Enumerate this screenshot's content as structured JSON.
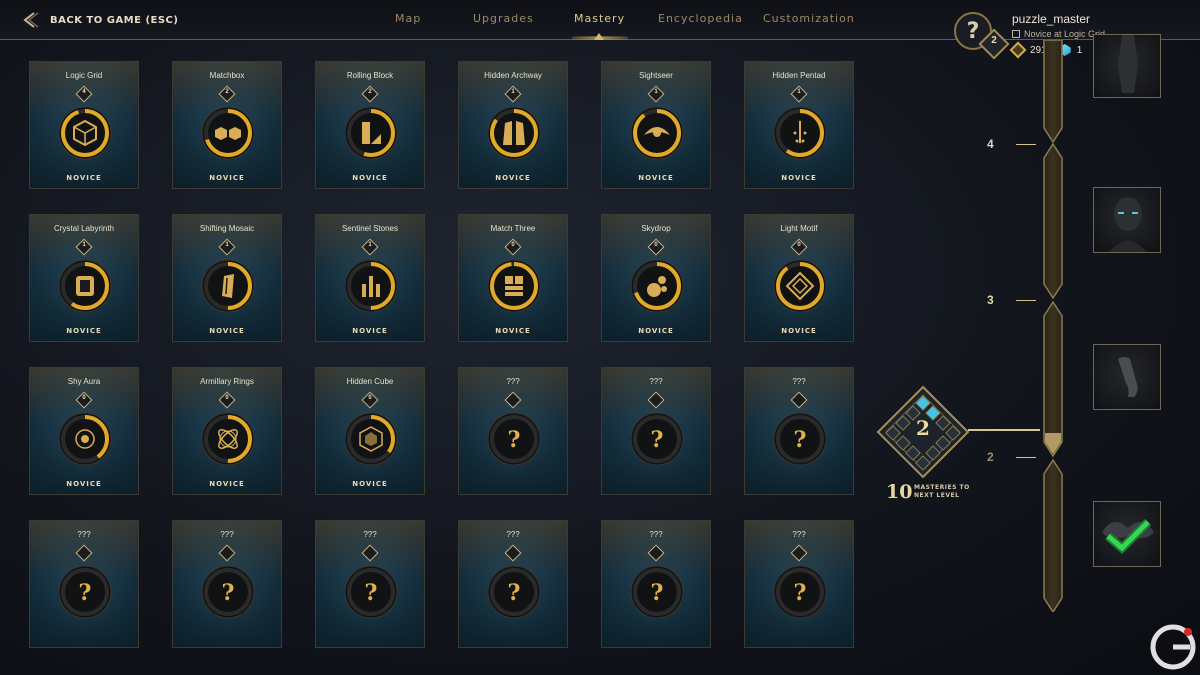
{
  "topbar": {
    "back_label": "BACK TO GAME (ESC)",
    "tabs": [
      {
        "label": "Map",
        "active": false
      },
      {
        "label": "Upgrades",
        "active": false
      },
      {
        "label": "Mastery",
        "active": true
      },
      {
        "label": "Encyclopedia",
        "active": false
      },
      {
        "label": "Customization",
        "active": false
      }
    ]
  },
  "profile": {
    "avatar_glyph": "?",
    "level": "2",
    "username": "puzzle_master",
    "rank_text": "Novice at Logic Grid",
    "coins": "291",
    "gems": "1"
  },
  "colors": {
    "accent_gold": "#e0a928",
    "ring_track": "#2a2a2a",
    "text_gold": "#e8d7a8",
    "gem_cyan": "#3fc6e8",
    "check_green": "#29c84a"
  },
  "cards": [
    {
      "name": "Logic Grid",
      "count": "4",
      "rank": "NOVICE",
      "progress": 0.95,
      "icon": "cube-icon",
      "locked": false
    },
    {
      "name": "Matchbox",
      "count": "2",
      "rank": "NOVICE",
      "progress": 0.7,
      "icon": "cubes-icon",
      "locked": false
    },
    {
      "name": "Rolling Block",
      "count": "2",
      "rank": "NOVICE",
      "progress": 0.55,
      "icon": "book-block-icon",
      "locked": false
    },
    {
      "name": "Hidden Archway",
      "count": "1",
      "rank": "NOVICE",
      "progress": 0.85,
      "icon": "archway-icon",
      "locked": false
    },
    {
      "name": "Sightseer",
      "count": "1",
      "rank": "NOVICE",
      "progress": 0.9,
      "icon": "eye-icon",
      "locked": false
    },
    {
      "name": "Hidden Pentad",
      "count": "1",
      "rank": "NOVICE",
      "progress": 0.6,
      "icon": "pentad-icon",
      "locked": false
    },
    {
      "name": "Crystal Labyrinth",
      "count": "1",
      "rank": "NOVICE",
      "progress": 0.6,
      "icon": "scroll-icon",
      "locked": false
    },
    {
      "name": "Shifting Mosaic",
      "count": "1",
      "rank": "NOVICE",
      "progress": 0.5,
      "icon": "mosaic-icon",
      "locked": false
    },
    {
      "name": "Sentinel Stones",
      "count": "1",
      "rank": "NOVICE",
      "progress": 0.5,
      "icon": "stones-icon",
      "locked": false
    },
    {
      "name": "Match Three",
      "count": "0",
      "rank": "NOVICE",
      "progress": 0.98,
      "icon": "grid-tiles-icon",
      "locked": false
    },
    {
      "name": "Skydrop",
      "count": "0",
      "rank": "NOVICE",
      "progress": 0.7,
      "icon": "spheres-icon",
      "locked": false
    },
    {
      "name": "Light Motif",
      "count": "0",
      "rank": "NOVICE",
      "progress": 0.9,
      "icon": "motif-icon",
      "locked": false
    },
    {
      "name": "Shy Aura",
      "count": "0",
      "rank": "NOVICE",
      "progress": 0.4,
      "icon": "aura-icon",
      "locked": false
    },
    {
      "name": "Armillary Rings",
      "count": "0",
      "rank": "NOVICE",
      "progress": 0.5,
      "icon": "rings-icon",
      "locked": false
    },
    {
      "name": "Hidden Cube",
      "count": "0",
      "rank": "NOVICE",
      "progress": 0.35,
      "icon": "hidden-cube-icon",
      "locked": false
    },
    {
      "name": "???",
      "locked": true
    },
    {
      "name": "???",
      "locked": true
    },
    {
      "name": "???",
      "locked": true
    },
    {
      "name": "???",
      "locked": true
    },
    {
      "name": "???",
      "locked": true
    },
    {
      "name": "???",
      "locked": true
    },
    {
      "name": "???",
      "locked": true
    },
    {
      "name": "???",
      "locked": true
    },
    {
      "name": "???",
      "locked": true
    }
  ],
  "locked_glyph": "?",
  "track": {
    "levels": [
      "4",
      "3",
      "2"
    ],
    "current_level": "2",
    "current_level_fill": 0.15,
    "rewards": [
      {
        "name": "statue-reward",
        "claimed": false
      },
      {
        "name": "portrait-reward",
        "claimed": false
      },
      {
        "name": "arm-reward",
        "claimed": false
      },
      {
        "name": "emblem-reward",
        "claimed": true
      }
    ]
  },
  "masteries": {
    "count": "10",
    "label": "MASTERIES TO NEXT LEVEL"
  }
}
